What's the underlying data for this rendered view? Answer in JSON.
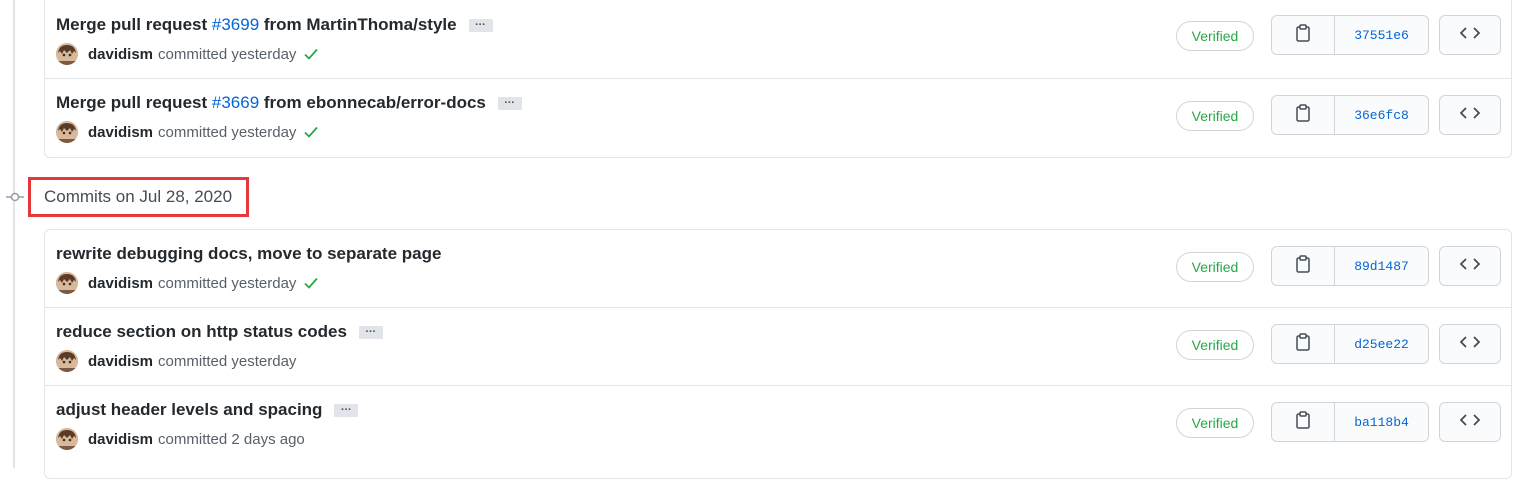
{
  "date_header": "Commits on Jul 28, 2020",
  "colors": {
    "link": "#0366d6",
    "verified": "#28a745",
    "highlight": "#e5383b",
    "border": "#e1e4e8"
  },
  "labels": {
    "verified": "Verified",
    "committed": "committed",
    "ellipsis": "…"
  },
  "icons": {
    "copy": "clipboard-icon",
    "browse": "code-icon",
    "status": "check-icon",
    "timeline": "git-commit-icon"
  },
  "groups": [
    {
      "commits": [
        {
          "message_pre": "Merge pull request ",
          "pr": "#3699",
          "message_post": " from MartinThoma/style",
          "author": "davidism",
          "when": "yesterday",
          "sha": "37551e6",
          "check": true
        },
        {
          "message_pre": "Merge pull request ",
          "pr": "#3669",
          "message_post": " from ebonnecab/error-docs",
          "author": "davidism",
          "when": "yesterday",
          "sha": "36e6fc8",
          "check": true
        }
      ]
    },
    {
      "commits": [
        {
          "message_pre": "rewrite debugging docs, move to separate page",
          "pr": "",
          "message_post": "",
          "author": "davidism",
          "when": "yesterday",
          "sha": "89d1487",
          "check": true
        },
        {
          "message_pre": "reduce section on http status codes",
          "pr": "",
          "message_post": "",
          "author": "davidism",
          "when": "yesterday",
          "sha": "d25ee22",
          "check": false
        },
        {
          "message_pre": "adjust header levels and spacing",
          "pr": "",
          "message_post": "",
          "author": "davidism",
          "when": "2 days ago",
          "sha": "ba118b4",
          "check": false
        }
      ]
    }
  ]
}
